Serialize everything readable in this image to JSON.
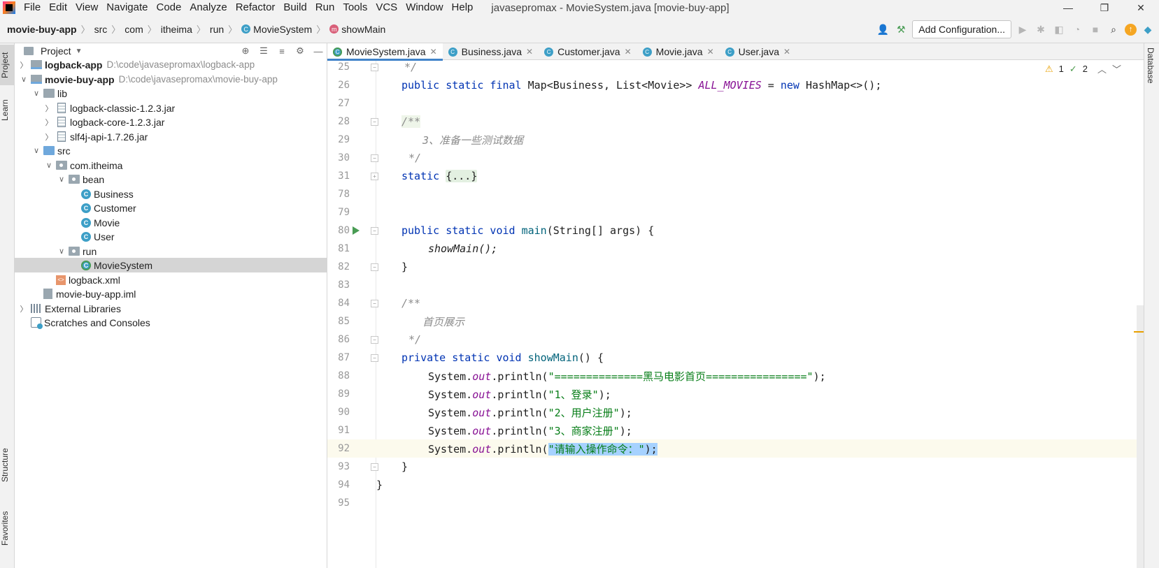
{
  "menubar": {
    "items": [
      "File",
      "Edit",
      "View",
      "Navigate",
      "Code",
      "Analyze",
      "Refactor",
      "Build",
      "Run",
      "Tools",
      "VCS",
      "Window",
      "Help"
    ],
    "title": "javasepromax - MovieSystem.java [movie-buy-app]"
  },
  "breadcrumb": {
    "project": "movie-buy-app",
    "parts": [
      "src",
      "com",
      "itheima",
      "run"
    ],
    "class": "MovieSystem",
    "method": "showMain"
  },
  "toolbar": {
    "add_config": "Add Configuration..."
  },
  "stripes": {
    "project": "Project",
    "learn": "Learn",
    "structure": "Structure",
    "favorites": "Favorites",
    "database": "Database"
  },
  "project_panel": {
    "title": "Project",
    "tree": [
      {
        "label": "logback-app",
        "hint": "D:\\code\\javasepromax\\logback-app"
      },
      {
        "label": "movie-buy-app",
        "hint": "D:\\code\\javasepromax\\movie-buy-app"
      },
      {
        "label": "lib"
      },
      {
        "label": "logback-classic-1.2.3.jar"
      },
      {
        "label": "logback-core-1.2.3.jar"
      },
      {
        "label": "slf4j-api-1.7.26.jar"
      },
      {
        "label": "src"
      },
      {
        "label": "com.itheima"
      },
      {
        "label": "bean"
      },
      {
        "label": "Business"
      },
      {
        "label": "Customer"
      },
      {
        "label": "Movie"
      },
      {
        "label": "User"
      },
      {
        "label": "run"
      },
      {
        "label": "MovieSystem"
      },
      {
        "label": "logback.xml"
      },
      {
        "label": "movie-buy-app.iml"
      },
      {
        "label": "External Libraries"
      },
      {
        "label": "Scratches and Consoles"
      }
    ]
  },
  "editor_tabs": [
    "MovieSystem.java",
    "Business.java",
    "Customer.java",
    "Movie.java",
    "User.java"
  ],
  "inspections": {
    "warnings": "1",
    "ok": "2"
  },
  "code": {
    "line_numbers": [
      "25",
      "26",
      "27",
      "28",
      "29",
      "30",
      "31",
      "78",
      "79",
      "80",
      "81",
      "82",
      "83",
      "84",
      "85",
      "86",
      "87",
      "88",
      "89",
      "90",
      "91",
      "92",
      "93",
      "94",
      "95"
    ],
    "l25": "*/",
    "l26_mod": "public static final ",
    "l26_type": "Map<Business, List<Movie>> ",
    "l26_field": "ALL_MOVIES",
    "l26_eq": " = ",
    "l26_new": "new ",
    "l26_rest": "HashMap<>();",
    "l28": "/**",
    "l29": "3、准备一些测试数据",
    "l30": "*/",
    "l31_kw": "static ",
    "l31_fold": "{...}",
    "l80_mod": "public static void ",
    "l80_fn": "main",
    "l80_rest": "(String[] args) {",
    "l81": "showMain();",
    "l82": "}",
    "l84": "/**",
    "l85": "首页展示",
    "l86": "*/",
    "l87_mod": "private static void ",
    "l87_fn": "showMain",
    "l87_rest": "() {",
    "sys": "System.",
    "out": "out",
    "println": ".println(",
    "end": ");",
    "l88_str": "\"==============黑马电影首页================\"",
    "l89_str": "\"1、登录\"",
    "l90_str": "\"2、用户注册\"",
    "l91_str": "\"3、商家注册\"",
    "l92_str": "\"请输入操作命令：\"",
    "l93": "}",
    "l94": "}"
  }
}
